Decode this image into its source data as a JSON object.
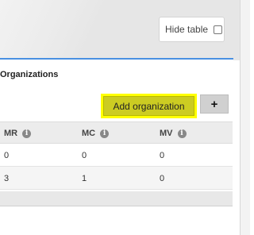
{
  "hide_table": {
    "label": "Hide table",
    "checked": false
  },
  "panel": {
    "title": "Organizations",
    "add_label": "Add organization",
    "plus_label": "+"
  },
  "table": {
    "columns": [
      {
        "label": "MR",
        "icon": "info-icon"
      },
      {
        "label": "MC",
        "icon": "info-icon"
      },
      {
        "label": "MV",
        "icon": "info-icon"
      }
    ],
    "rows": [
      [
        "0",
        "0",
        "0"
      ],
      [
        "3",
        "1",
        "0"
      ]
    ]
  },
  "colors": {
    "accent": "#4a90e2",
    "highlight": "#ffff00",
    "button": "#cccc22"
  }
}
